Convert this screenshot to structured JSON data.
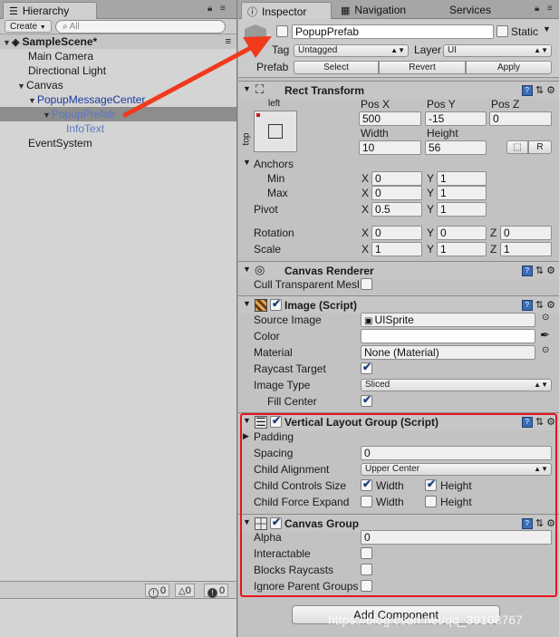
{
  "hierarchy": {
    "tab_label": "Hierarchy",
    "create_label": "Create",
    "search_placeholder": "All",
    "scene_name": "SampleScene*",
    "items": [
      {
        "label": "Main Camera"
      },
      {
        "label": "Directional Light"
      },
      {
        "label": "Canvas"
      },
      {
        "label": "PopupMessageCenter"
      },
      {
        "label": "PopupPrefab"
      },
      {
        "label": "InfoText"
      },
      {
        "label": "EventSystem"
      }
    ],
    "console_counts": {
      "info": "0",
      "warn": "0",
      "error": "0"
    }
  },
  "tabs": {
    "inspector": "Inspector",
    "navigation": "Navigation",
    "services": "Services"
  },
  "object": {
    "name": "PopupPrefab",
    "static_label": "Static",
    "tag_label": "Tag",
    "tag_value": "Untagged",
    "layer_label": "Layer",
    "layer_value": "UI",
    "prefab_label": "Prefab",
    "select_label": "Select",
    "revert_label": "Revert",
    "apply_label": "Apply"
  },
  "rect_transform": {
    "title": "Rect Transform",
    "anchor_h": "left",
    "anchor_v": "top",
    "posx_label": "Pos X",
    "posy_label": "Pos Y",
    "posz_label": "Pos Z",
    "posx": "500",
    "posy": "-15",
    "posz": "0",
    "width_label": "Width",
    "height_label": "Height",
    "width": "10",
    "height": "56",
    "r_label": "R",
    "anchors_label": "Anchors",
    "min_label": "Min",
    "max_label": "Max",
    "min_x": "0",
    "min_y": "1",
    "max_x": "0",
    "max_y": "1",
    "pivot_label": "Pivot",
    "pivot_x": "0.5",
    "pivot_y": "1",
    "rotation_label": "Rotation",
    "rot_x": "0",
    "rot_y": "0",
    "rot_z": "0",
    "scale_label": "Scale",
    "scale_x": "1",
    "scale_y": "1",
    "scale_z": "1",
    "x": "X",
    "y": "Y",
    "z": "Z"
  },
  "canvas_renderer": {
    "title": "Canvas Renderer",
    "cull_label": "Cull Transparent Mesh"
  },
  "image": {
    "title": "Image (Script)",
    "source_label": "Source Image",
    "source_value": "UISprite",
    "color_label": "Color",
    "material_label": "Material",
    "material_value": "None (Material)",
    "raycast_label": "Raycast Target",
    "type_label": "Image Type",
    "type_value": "Sliced",
    "fill_label": "Fill Center"
  },
  "vertical_layout": {
    "title": "Vertical Layout Group (Script)",
    "padding_label": "Padding",
    "spacing_label": "Spacing",
    "spacing_value": "0",
    "alignment_label": "Child Alignment",
    "alignment_value": "Upper Center",
    "controls_label": "Child Controls Size",
    "expand_label": "Child Force Expand",
    "width_label": "Width",
    "height_label": "Height"
  },
  "canvas_group": {
    "title": "Canvas Group",
    "alpha_label": "Alpha",
    "alpha_value": "0",
    "interactable_label": "Interactable",
    "blocks_label": "Blocks Raycasts",
    "ignore_label": "Ignore Parent Groups"
  },
  "add_component_label": "Add Component",
  "watermark": "https://blog.csdn.net/qq_39108767",
  "colors": {
    "highlight_box": "#e8141c",
    "arrow": "#f03a1e",
    "link_blue": "#1a3a9c"
  }
}
